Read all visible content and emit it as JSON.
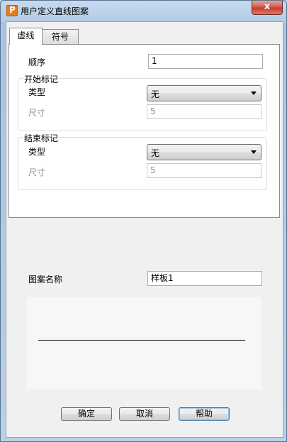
{
  "window": {
    "title": "用户定义直线图案",
    "close_glyph": "x"
  },
  "tabs": [
    {
      "label": "虚线",
      "active": true
    },
    {
      "label": "符号",
      "active": false
    }
  ],
  "order": {
    "label": "顺序",
    "value": "1"
  },
  "start_mark": {
    "group_label": "开始标记",
    "type_label": "类型",
    "type_value": "无",
    "size_label": "尺寸",
    "size_value": "5"
  },
  "end_mark": {
    "group_label": "结束标记",
    "type_label": "类型",
    "type_value": "无",
    "size_label": "尺寸",
    "size_value": "5"
  },
  "pattern_name": {
    "label": "图案名称",
    "value": "样板1"
  },
  "buttons": {
    "ok": "确定",
    "cancel": "取消",
    "help": "帮助"
  }
}
